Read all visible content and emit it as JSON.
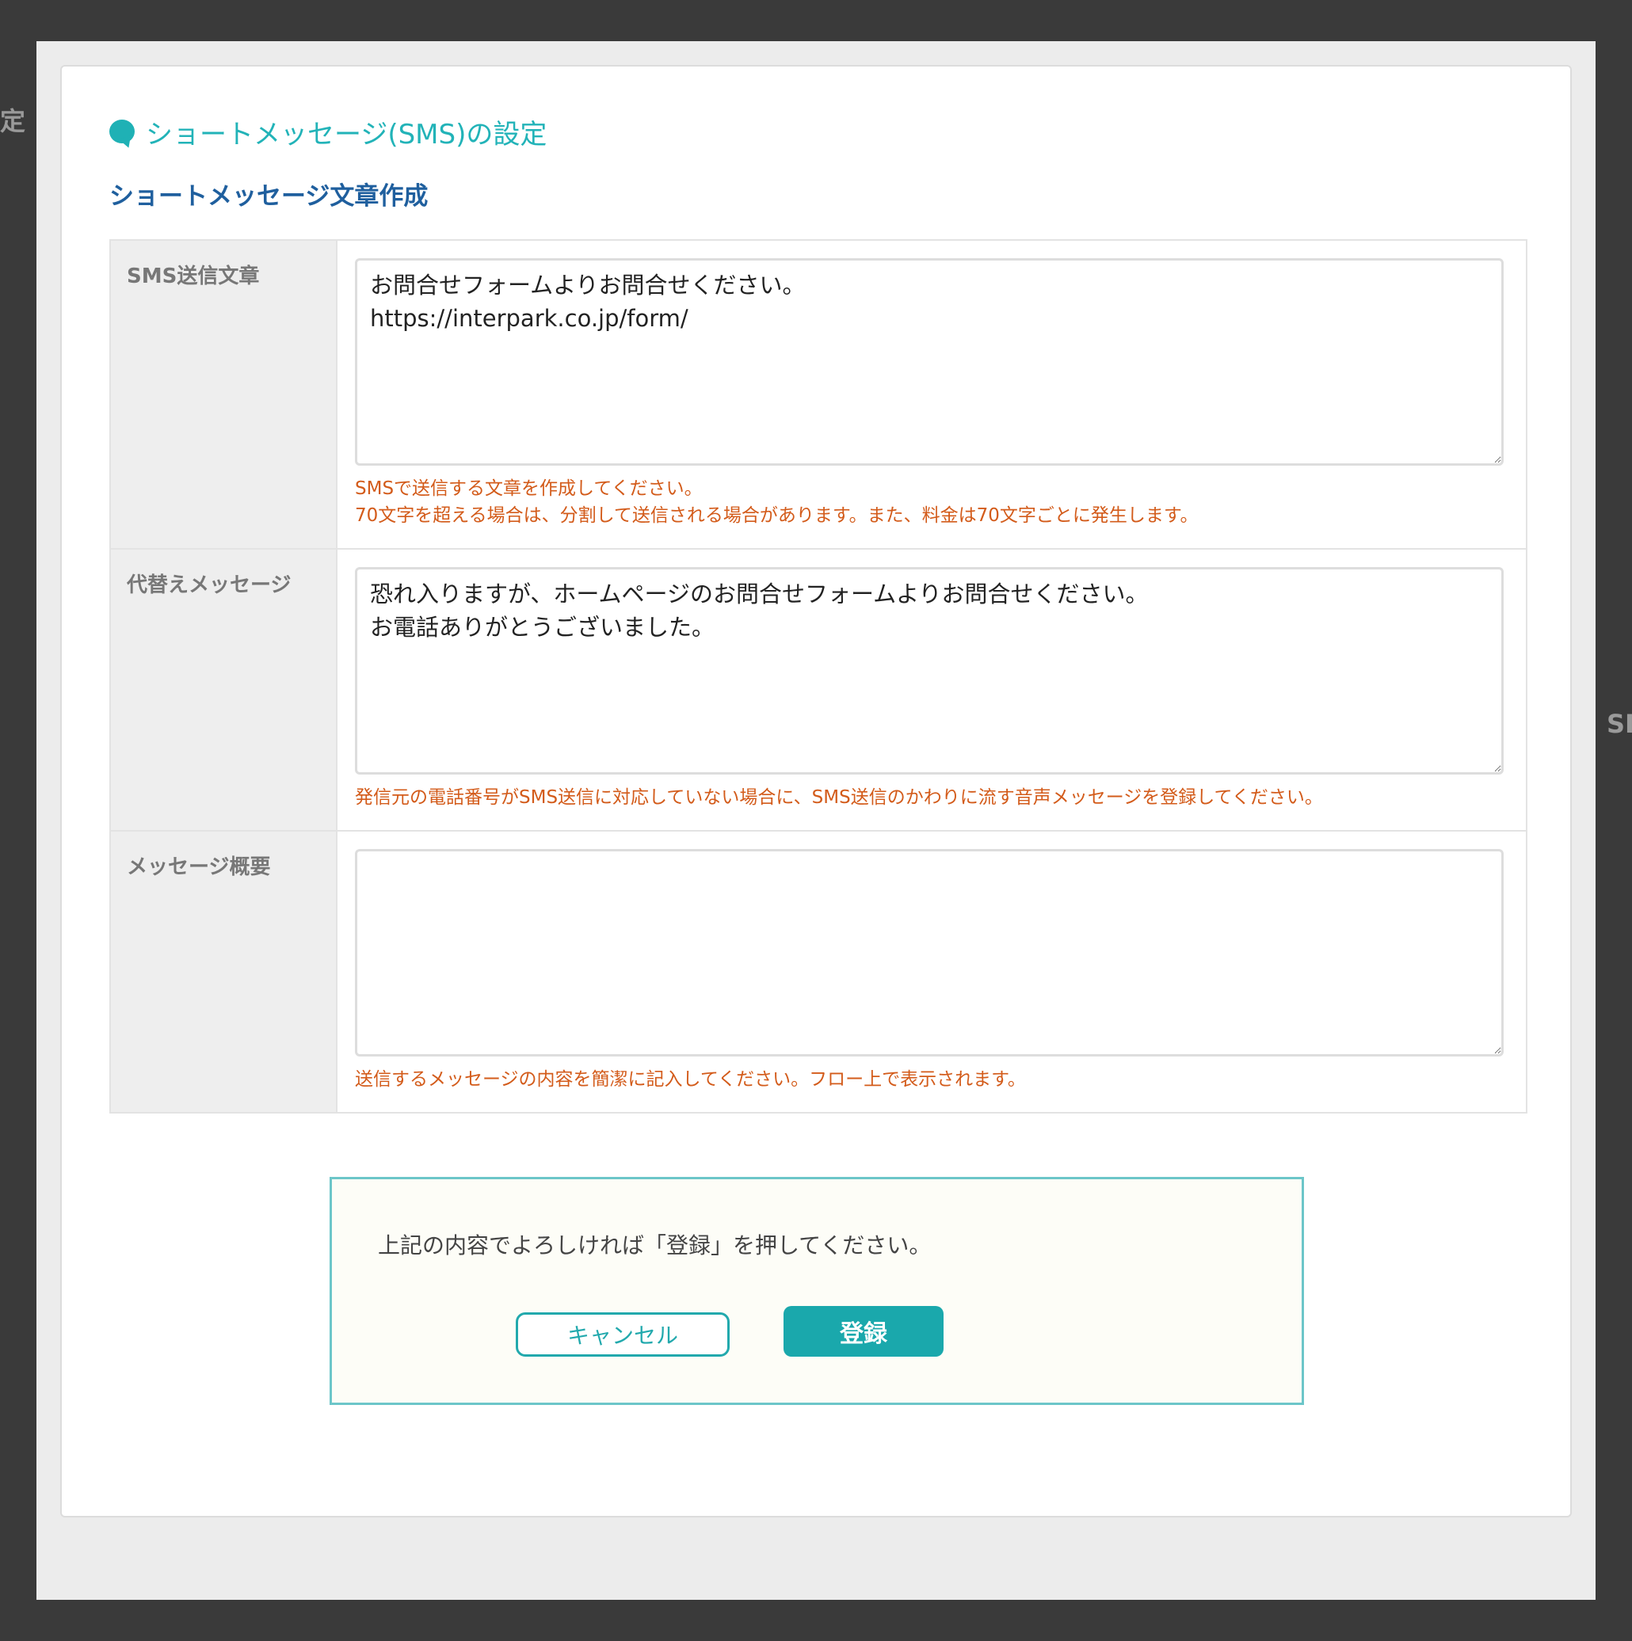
{
  "modal": {
    "title": "ショートメッセージ(SMS)の設定",
    "section_title": "ショートメッセージ文章作成"
  },
  "form": {
    "rows": [
      {
        "label": "SMS送信文章",
        "value": "お問合せフォームよりお問合せください。\nhttps://interpark.co.jp/form/",
        "hints": [
          "SMSで送信する文章を作成してください。",
          "70文字を超える場合は、分割して送信される場合があります。また、料金は70文字ごとに発生します。"
        ]
      },
      {
        "label": "代替えメッセージ",
        "value": "恐れ入りますが、ホームページのお問合せフォームよりお問合せください。\nお電話ありがとうございました。",
        "hints": [
          "発信元の電話番号がSMS送信に対応していない場合に、SMS送信のかわりに流す音声メッセージを登録してください。"
        ]
      },
      {
        "label": "メッセージ概要",
        "value": "",
        "hints": [
          "送信するメッセージの内容を簡潔に記入してください。フロー上で表示されます。"
        ]
      }
    ]
  },
  "confirm": {
    "text": "上記の内容でよろしければ「登録」を押してください。",
    "cancel_label": "キャンセル",
    "submit_label": "登録"
  },
  "background_peek": {
    "left_top": "定",
    "right_1": "SI"
  },
  "colors": {
    "accent": "#1aa8ac",
    "section_title": "#1f5f9e",
    "hint": "#d35b1a"
  }
}
